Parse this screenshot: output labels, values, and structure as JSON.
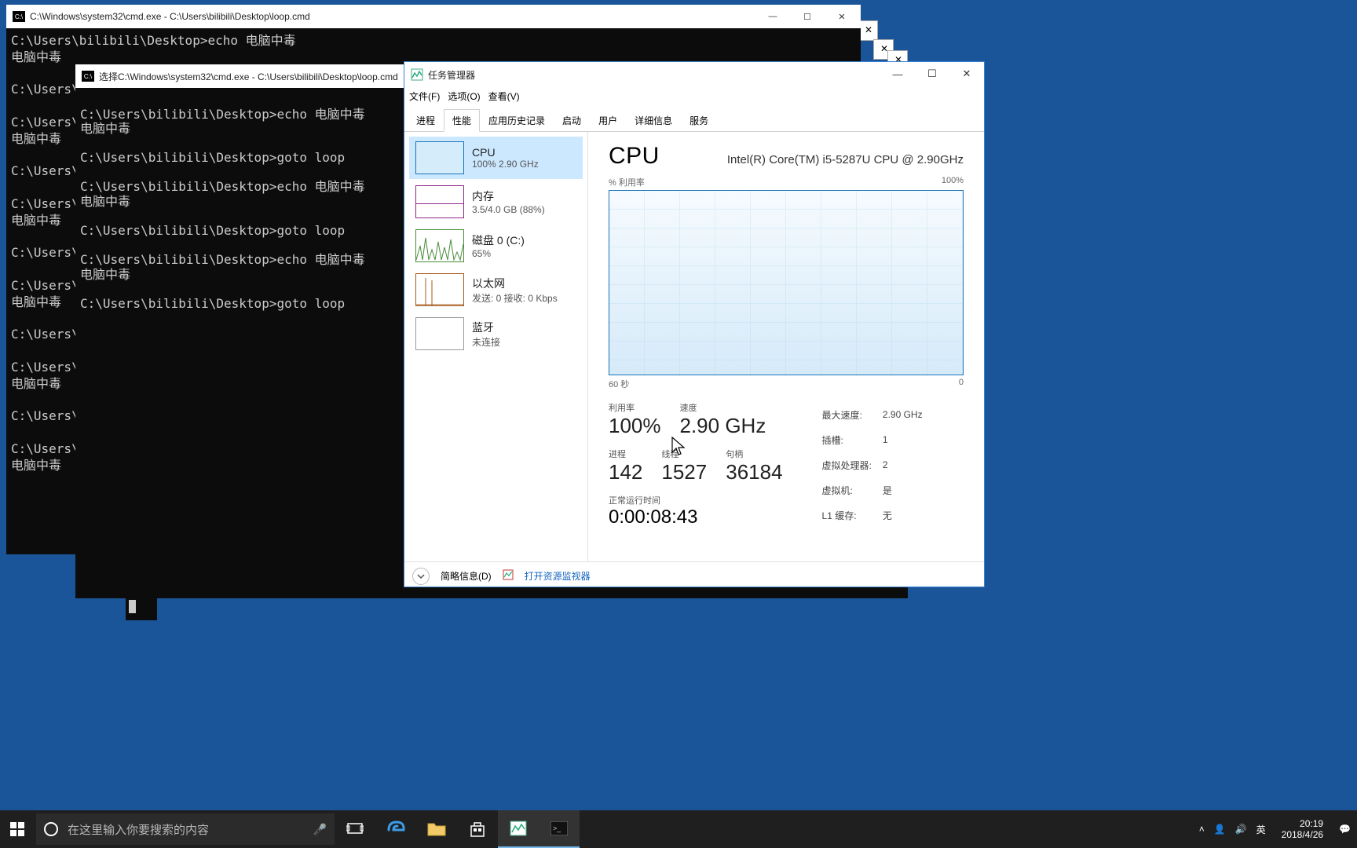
{
  "cmd1": {
    "title": "C:\\Windows\\system32\\cmd.exe - C:\\Users\\bilibili\\Desktop\\loop.cmd",
    "lines": "C:\\Users\\bilibili\\Desktop>echo 电脑中毒\n电脑中毒\n\nC:\\Users\\\n\nC:\\Users\\\n电脑中毒\n\nC:\\Users\\\n\nC:\\Users\\\n电脑中毒\n\nC:\\Users\\\n\nC:\\Users\\\n电脑中毒\n\nC:\\Users\\\n\nC:\\Users\\\n电脑中毒\n\nC:\\Users\\\n\nC:\\Users\\\n电脑中毒"
  },
  "cmd2": {
    "title": "选择C:\\Windows\\system32\\cmd.exe - C:\\Users\\bilibili\\Desktop\\loop.cmd",
    "lines": "\nC:\\Users\\bilibili\\Desktop>echo 电脑中毒\n电脑中毒\n\nC:\\Users\\bilibili\\Desktop>goto loop\n\nC:\\Users\\bilibili\\Desktop>echo 电脑中毒\n电脑中毒\n\nC:\\Users\\bilibili\\Desktop>goto loop\n\nC:\\Users\\bilibili\\Desktop>echo 电脑中毒\n电脑中毒\n\nC:\\Users\\bilibili\\Desktop>goto loop"
  },
  "cmd_bg": {
    "line1": "C:\\Users\\bilibili\\Desktop>goto loop",
    "line2": "C:\\Users\\bilibili\\Desktop>goto loop"
  },
  "taskmgr": {
    "title": "任务管理器",
    "menu": {
      "file": "文件(F)",
      "options": "选项(O)",
      "view": "查看(V)"
    },
    "tabs": {
      "proc": "进程",
      "perf": "性能",
      "hist": "应用历史记录",
      "startup": "启动",
      "users": "用户",
      "details": "详细信息",
      "services": "服务"
    },
    "side": {
      "cpu": {
        "name": "CPU",
        "sub": "100%  2.90 GHz"
      },
      "mem": {
        "name": "内存",
        "sub": "3.5/4.0 GB (88%)"
      },
      "disk": {
        "name": "磁盘 0 (C:)",
        "sub": "65%"
      },
      "eth": {
        "name": "以太网",
        "sub": "发送: 0  接收: 0 Kbps"
      },
      "bt": {
        "name": "蓝牙",
        "sub": "未连接"
      }
    },
    "detail": {
      "heading": "CPU",
      "model": "Intel(R) Core(TM) i5-5287U CPU @ 2.90GHz",
      "chart_top_l": "% 利用率",
      "chart_top_r": "100%",
      "chart_bot_l": "60 秒",
      "chart_bot_r": "0",
      "util_lbl": "利用率",
      "util_val": "100%",
      "speed_lbl": "速度",
      "speed_val": "2.90 GHz",
      "proc_lbl": "进程",
      "proc_val": "142",
      "threads_lbl": "线程",
      "threads_val": "1527",
      "handles_lbl": "句柄",
      "handles_val": "36184",
      "uptime_lbl": "正常运行时间",
      "uptime_val": "0:00:08:43",
      "info": {
        "maxspeed_lbl": "最大速度:",
        "maxspeed_val": "2.90 GHz",
        "sockets_lbl": "插槽:",
        "sockets_val": "1",
        "logical_lbl": "虚拟处理器:",
        "logical_val": "2",
        "virt_lbl": "虚拟机:",
        "virt_val": "是",
        "l1_lbl": "L1 缓存:",
        "l1_val": "无"
      }
    },
    "footer": {
      "collapse": "简略信息(D)",
      "resmon": "打开资源监视器"
    }
  },
  "taskbar": {
    "search_ph": "在这里输入你要搜索的内容",
    "ime": "英",
    "time": "20:19",
    "date": "2018/4/26"
  },
  "chart_data": {
    "type": "area",
    "title": "% 利用率",
    "xlabel": "60 秒",
    "ylabel": "",
    "ylim": [
      0,
      100
    ],
    "x_range_seconds": [
      60,
      0
    ],
    "values_percent": [
      100,
      100,
      100,
      100,
      100,
      100,
      100,
      100,
      100,
      100,
      100,
      100,
      100,
      100,
      100,
      100,
      100,
      100,
      100,
      100
    ],
    "note": "CPU utilization flat at 100% for visible window"
  }
}
